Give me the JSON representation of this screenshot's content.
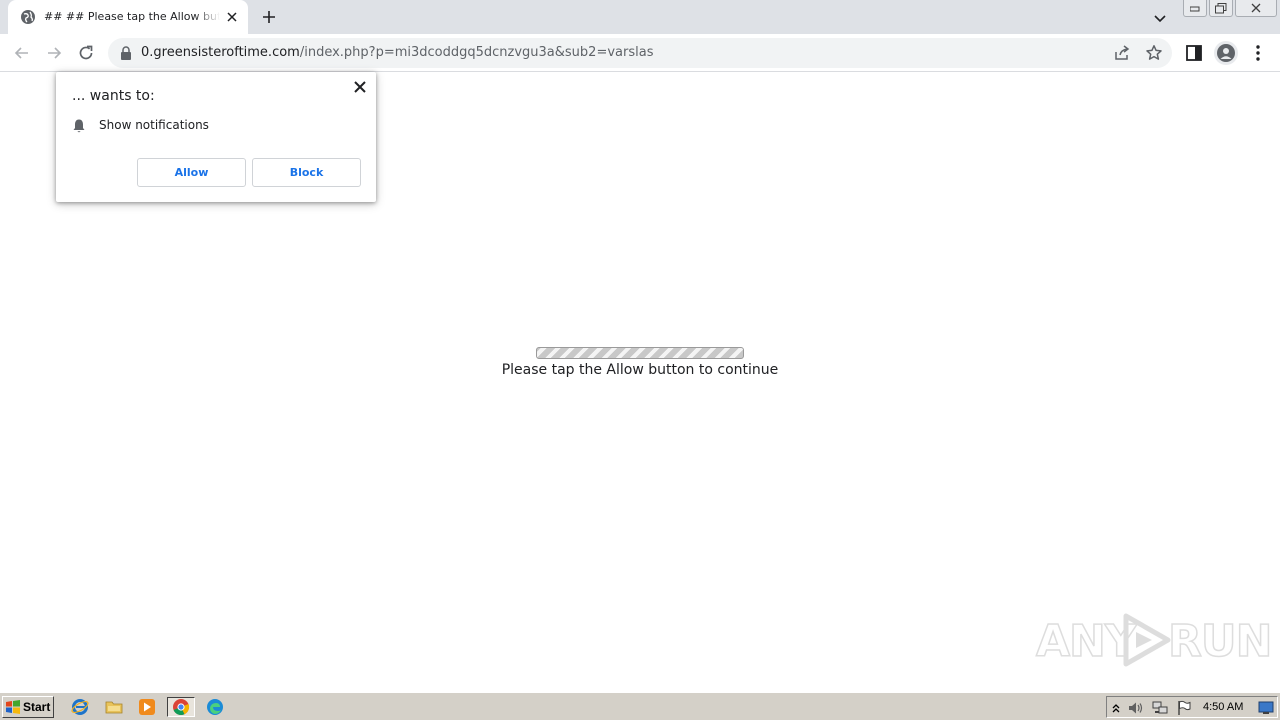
{
  "browser": {
    "tab": {
      "title": "## ## Please tap the Allow button to continue"
    },
    "url": {
      "host": "0.greensisteroftime.com",
      "path": "/index.php?p=mi3dcoddgq5dcnzvgu3a&sub2=varslas"
    }
  },
  "permission_popup": {
    "heading": "... wants to:",
    "permission": "Show notifications",
    "allow_label": "Allow",
    "block_label": "Block"
  },
  "page": {
    "message": "Please tap the Allow button to continue"
  },
  "watermark": {
    "left_text": "ANY",
    "right_text": "RUN"
  },
  "taskbar": {
    "start_label": "Start",
    "clock": "4:50 AM",
    "quick_launch": [
      "internet-explorer-icon",
      "folder-icon",
      "media-player-icon",
      "chrome-icon",
      "edge-icon"
    ]
  },
  "colors": {
    "accent": "#1a73e8",
    "tabstrip": "#dee1e6",
    "taskbar": "#d4d0c8"
  }
}
